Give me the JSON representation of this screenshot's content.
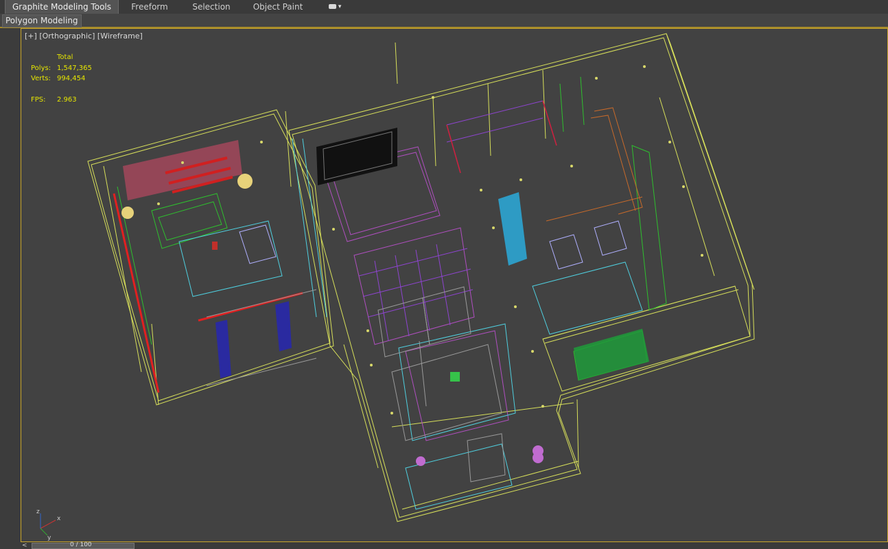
{
  "ribbon": {
    "tabs": [
      {
        "label": "Graphite Modeling Tools",
        "active": true
      },
      {
        "label": "Freeform"
      },
      {
        "label": "Selection"
      },
      {
        "label": "Object Paint"
      }
    ],
    "dropdown_icon": "dropdown-arrow-icon",
    "sub_tab": "Polygon Modeling"
  },
  "viewport": {
    "label_plus": "[+]",
    "label_view": "[Orthographic]",
    "label_shading": "[Wireframe]",
    "stats": {
      "header": "Total",
      "polys_label": "Polys:",
      "polys": "1,547,365",
      "verts_label": "Verts:",
      "verts": "994,454",
      "fps_label": "FPS:",
      "fps": "2.963"
    },
    "axis": {
      "x": "x",
      "y": "y",
      "z": "z"
    }
  },
  "time_slider": {
    "text": "0 / 100"
  },
  "colors": {
    "highlight": "#c9a62b",
    "stats_text": "#e6e600",
    "wire_yellow": "#d8e05a"
  }
}
